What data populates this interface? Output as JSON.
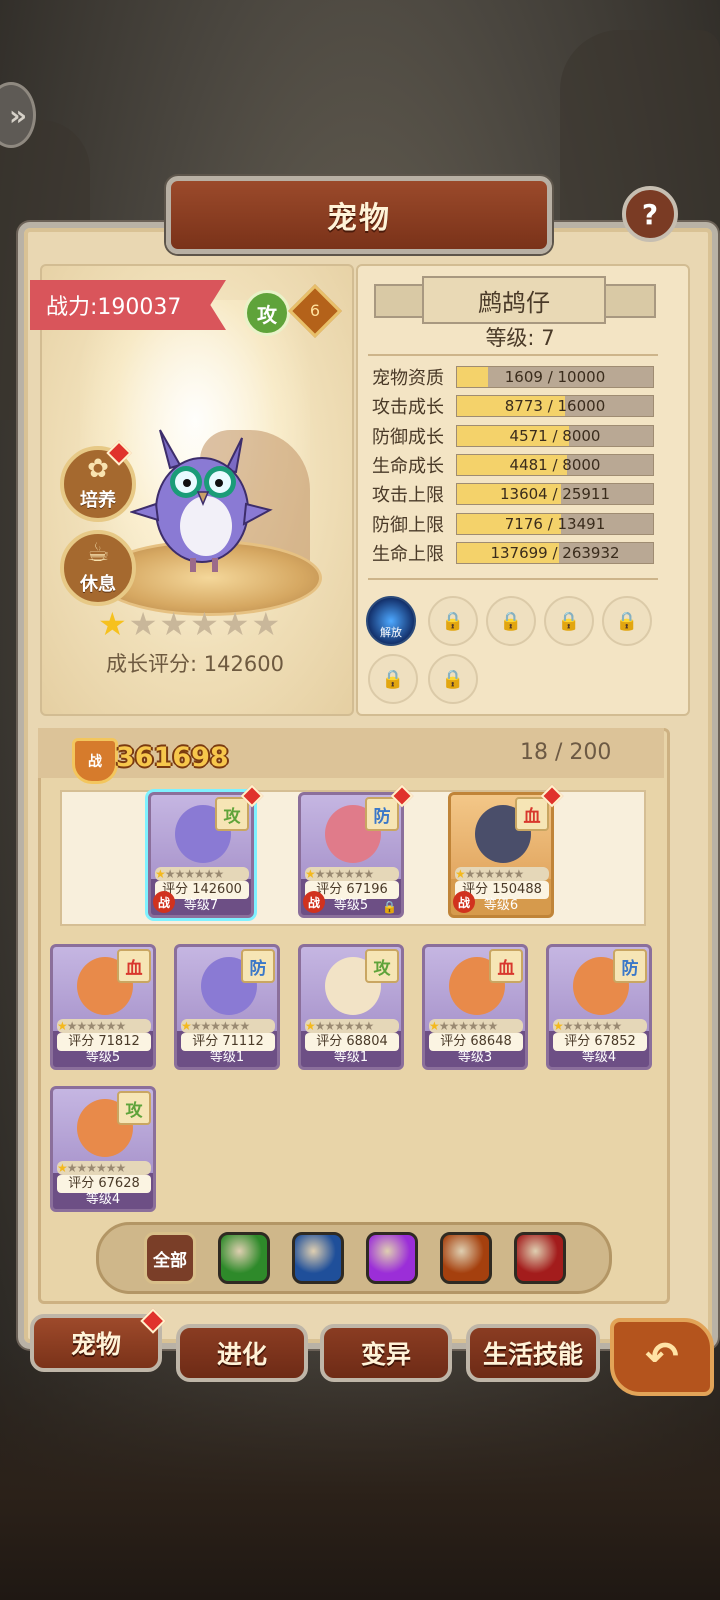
{
  "window": {
    "title": "宠物"
  },
  "pet": {
    "power_text": "战力:190037",
    "type": "攻",
    "level_lock": "6",
    "name": "鹧鸪仔",
    "level_text": "等级: 7",
    "stars_filled": 1,
    "stars_total": 7,
    "growth_score": "成长评分: 142600"
  },
  "actions": {
    "train_label": "培养",
    "rest_label": "休息"
  },
  "stats": [
    {
      "label": "宠物资质",
      "value": "1609 / 10000",
      "fraction": 0.16
    },
    {
      "label": "攻击成长",
      "value": "8773 / 16000",
      "fraction": 0.55
    },
    {
      "label": "防御成长",
      "value": "4571 / 8000",
      "fraction": 0.57
    },
    {
      "label": "生命成长",
      "value": "4481 / 8000",
      "fraction": 0.56
    },
    {
      "label": "攻击上限",
      "value": "13604 / 25911",
      "fraction": 0.53
    },
    {
      "label": "防御上限",
      "value": "7176 / 13491",
      "fraction": 0.53
    },
    {
      "label": "生命上限",
      "value": "137699 / 263932",
      "fraction": 0.52
    }
  ],
  "skills": {
    "active_label": "解放",
    "locked_count": 7
  },
  "roster": {
    "battle_mark": "战",
    "total_power": "361698",
    "capacity": "18 / 200"
  },
  "team_cards": [
    {
      "type": "攻",
      "score": "评分 142600",
      "level": "等级7",
      "stars": 1,
      "war": "战",
      "lock": false
    },
    {
      "type": "防",
      "score": "评分 67196",
      "level": "等级5",
      "stars": 1,
      "war": "战",
      "lock": true
    },
    {
      "type": "血",
      "score": "评分 150488",
      "level": "等级6",
      "stars": 1,
      "war": "战",
      "lock": false
    }
  ],
  "bench_cards": [
    {
      "type": "血",
      "score": "评分 71812",
      "level": "等级5",
      "stars": 1
    },
    {
      "type": "防",
      "score": "评分 71112",
      "level": "等级1",
      "stars": 1
    },
    {
      "type": "攻",
      "score": "评分 68804",
      "level": "等级1",
      "stars": 1
    },
    {
      "type": "血",
      "score": "评分 68648",
      "level": "等级3",
      "stars": 1
    },
    {
      "type": "防",
      "score": "评分 67852",
      "level": "等级4",
      "stars": 1
    },
    {
      "type": "攻",
      "score": "评分 67628",
      "level": "等级4",
      "stars": 1
    }
  ],
  "filter": {
    "all_label": "全部",
    "gem_colors": [
      "#2e8a2a",
      "#1f4f9a",
      "#9b2ed8",
      "#a5400e",
      "#a31c1c"
    ]
  },
  "nav": {
    "tabs": [
      "宠物",
      "进化",
      "变异",
      "生活技能"
    ],
    "active": 0
  },
  "colors": {
    "attack": "#5fa33a",
    "defense": "#3b78c8",
    "health": "#d8372d"
  }
}
